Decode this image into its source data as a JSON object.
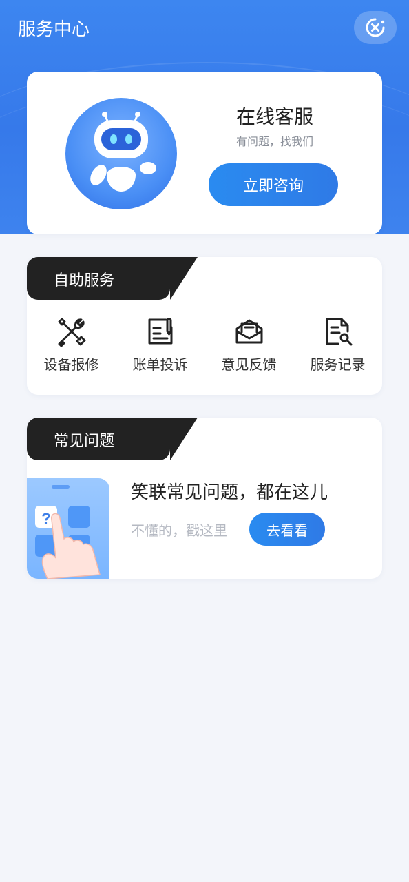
{
  "header": {
    "title": "服务中心",
    "close_icon": "close-circle-icon"
  },
  "online_service": {
    "title": "在线客服",
    "subtitle": "有问题，找我们",
    "button_label": "立即咨询",
    "avatar_icon": "robot-icon"
  },
  "self_service": {
    "tag": "自助服务",
    "items": [
      {
        "label": "设备报修",
        "icon": "tools-icon"
      },
      {
        "label": "账单投诉",
        "icon": "document-edit-icon"
      },
      {
        "label": "意见反馈",
        "icon": "mail-icon"
      },
      {
        "label": "服务记录",
        "icon": "record-icon"
      }
    ]
  },
  "faq": {
    "tag": "常见问题",
    "title": "笑联常见问题，都在这儿",
    "subtitle": "不懂的，戳这里",
    "button_label": "去看看",
    "illustration": "phone-faq-illustration"
  },
  "colors": {
    "brand_blue": "#2f7ae6",
    "header_blue": "#3679ea",
    "tag_black": "#222222",
    "background": "#f3f5fa"
  }
}
